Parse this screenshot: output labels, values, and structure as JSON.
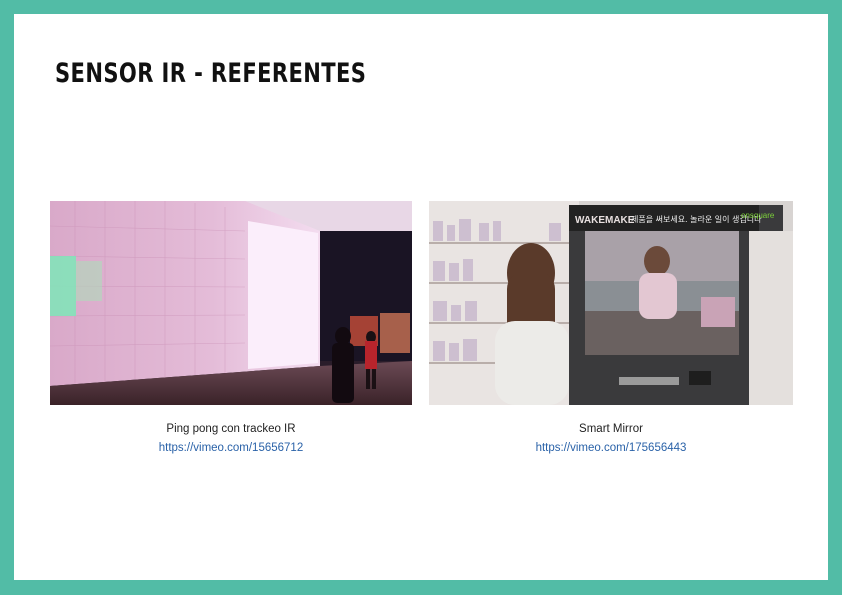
{
  "slide": {
    "title": "SENSOR IR - REFERENTES",
    "accent_color": "#52bca6"
  },
  "references": [
    {
      "caption": "Ping pong con trackeo IR",
      "url": "https://vimeo.com/15656712",
      "image": "ir-ping-pong-wall-photo"
    },
    {
      "caption": "Smart Mirror",
      "url": "https://vimeo.com/175656443",
      "image": "smart-mirror-photo",
      "image_text": {
        "brand": "WAKEMAKE",
        "korean_banner": "제품을 써보세요. 놀라운 일이 생깁니다",
        "logo": "onsquare"
      }
    }
  ]
}
